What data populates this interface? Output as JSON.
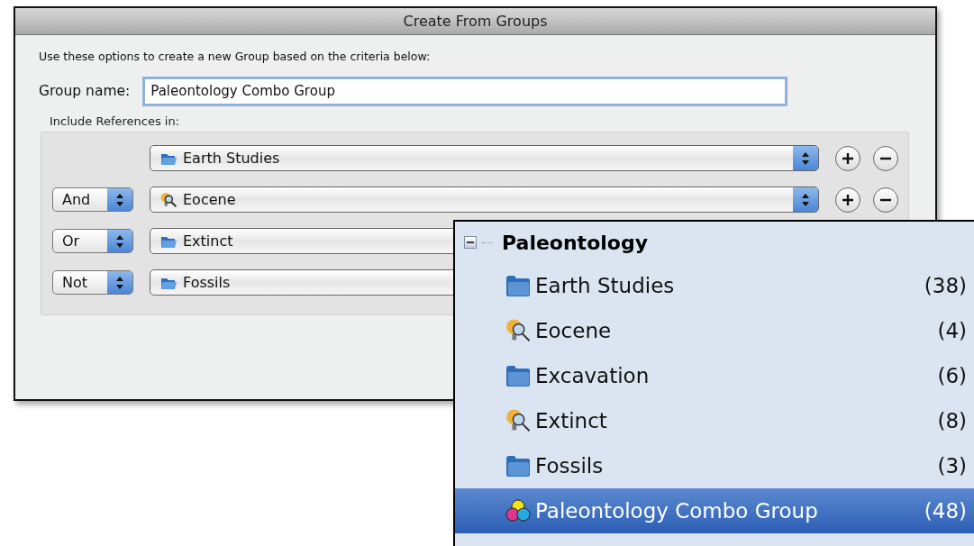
{
  "dialog": {
    "title": "Create From Groups",
    "intro": "Use these options to create a new Group based on the criteria below:",
    "group_name": {
      "label": "Group name:",
      "value": "Paleontology Combo Group"
    },
    "include_label": "Include References in:",
    "criteria": [
      {
        "kind": "folder",
        "label": "Earth Studies",
        "add_remove": true
      },
      {
        "operator": "And",
        "kind": "smart",
        "label": "Eocene",
        "add_remove": true
      },
      {
        "operator": "Or",
        "kind": "folder",
        "label": "Extinct"
      },
      {
        "operator": "Not",
        "kind": "folder",
        "label": "Fossils"
      }
    ]
  },
  "tree": {
    "label": "Paleontology",
    "expanded": true,
    "children": [
      {
        "kind": "folder",
        "label": "Earth Studies",
        "count": "(38)",
        "selected": false
      },
      {
        "kind": "smart",
        "label": "Eocene",
        "count": "(4)",
        "selected": false
      },
      {
        "kind": "folder",
        "label": "Excavation",
        "count": "(6)",
        "selected": false
      },
      {
        "kind": "smart",
        "label": "Extinct",
        "count": "(8)",
        "selected": false
      },
      {
        "kind": "folder",
        "label": "Fossils",
        "count": "(3)",
        "selected": false
      },
      {
        "kind": "combo",
        "label": "Paleontology Combo Group",
        "count": "(48)",
        "selected": true
      }
    ]
  }
}
